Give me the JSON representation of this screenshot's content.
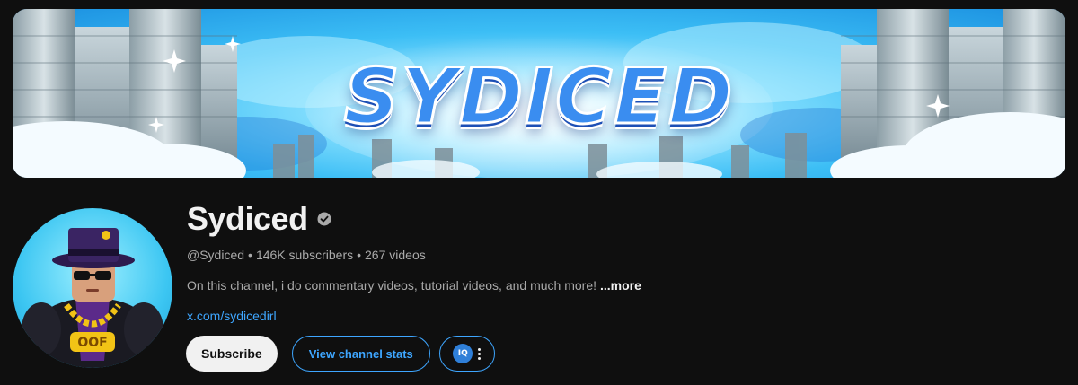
{
  "banner": {
    "title": "SYDICED"
  },
  "channel": {
    "name": "Sydiced",
    "handle": "@Sydiced",
    "subscribers": "146K subscribers",
    "videos": "267 videos",
    "separator": "•",
    "description": "On this channel, i do commentary videos, tutorial videos, and much more!",
    "more_label": "...more",
    "link": "x.com/sydicedirl",
    "verified_icon": "verified-check-icon"
  },
  "actions": {
    "subscribe_label": "Subscribe",
    "stats_label": "View channel stats",
    "extension_logo_text": "IQ",
    "more_icon": "kebab-menu-icon"
  },
  "colors": {
    "background": "#0f0f0f",
    "link_blue": "#3ea6ff",
    "text_secondary": "#aaaaaa",
    "subscribe_bg": "#f1f1f1"
  }
}
